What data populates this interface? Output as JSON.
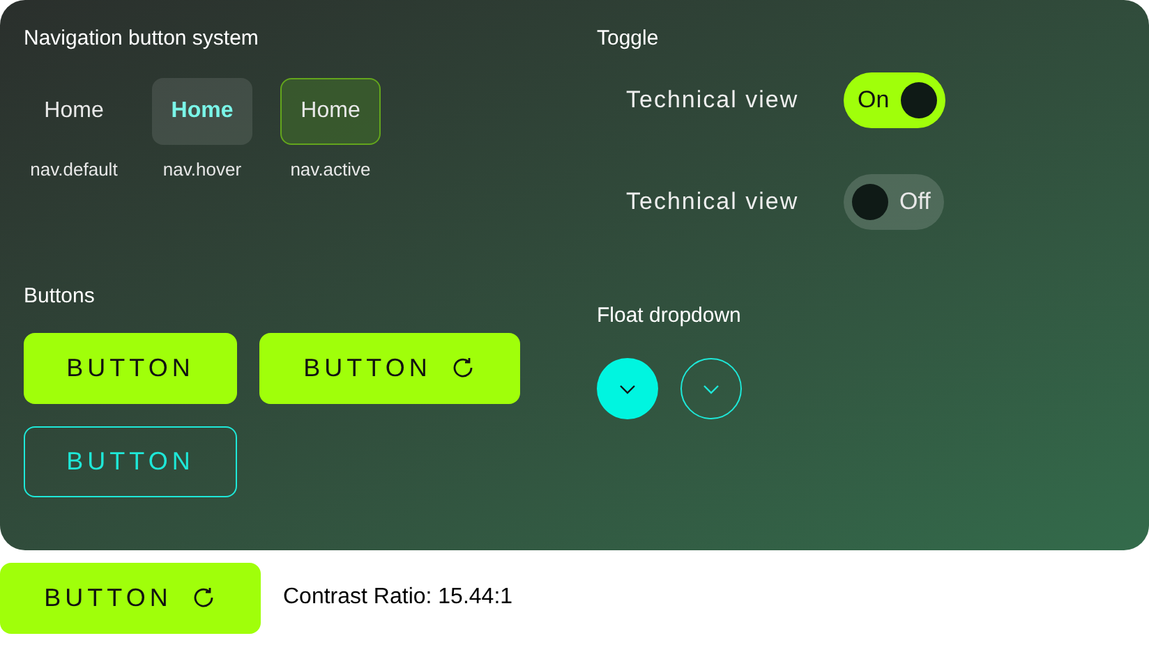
{
  "nav": {
    "title": "Navigation button system",
    "items": [
      {
        "label": "Home",
        "caption": "nav.default",
        "kind": "default"
      },
      {
        "label": "Home",
        "caption": "nav.hover",
        "kind": "hover"
      },
      {
        "label": "Home",
        "caption": "nav.active",
        "kind": "active"
      }
    ]
  },
  "toggle": {
    "title": "Toggle",
    "items": [
      {
        "label": "Technical view",
        "state_text": "On",
        "on": true
      },
      {
        "label": "Technical view",
        "state_text": "Off",
        "on": false
      }
    ]
  },
  "buttons": {
    "title": "Buttons",
    "items": [
      {
        "label": "BUTTON",
        "kind": "filled"
      },
      {
        "label": "BUTTON",
        "kind": "filled_icon"
      },
      {
        "label": "BUTTON",
        "kind": "outline"
      }
    ]
  },
  "dropdown": {
    "title": "Float dropdown",
    "items": [
      {
        "kind": "filled"
      },
      {
        "kind": "outline"
      }
    ]
  },
  "footer": {
    "button": {
      "label": "BUTTON",
      "kind": "filled_icon"
    },
    "contrast": "Contrast Ratio: 15.44:1"
  }
}
